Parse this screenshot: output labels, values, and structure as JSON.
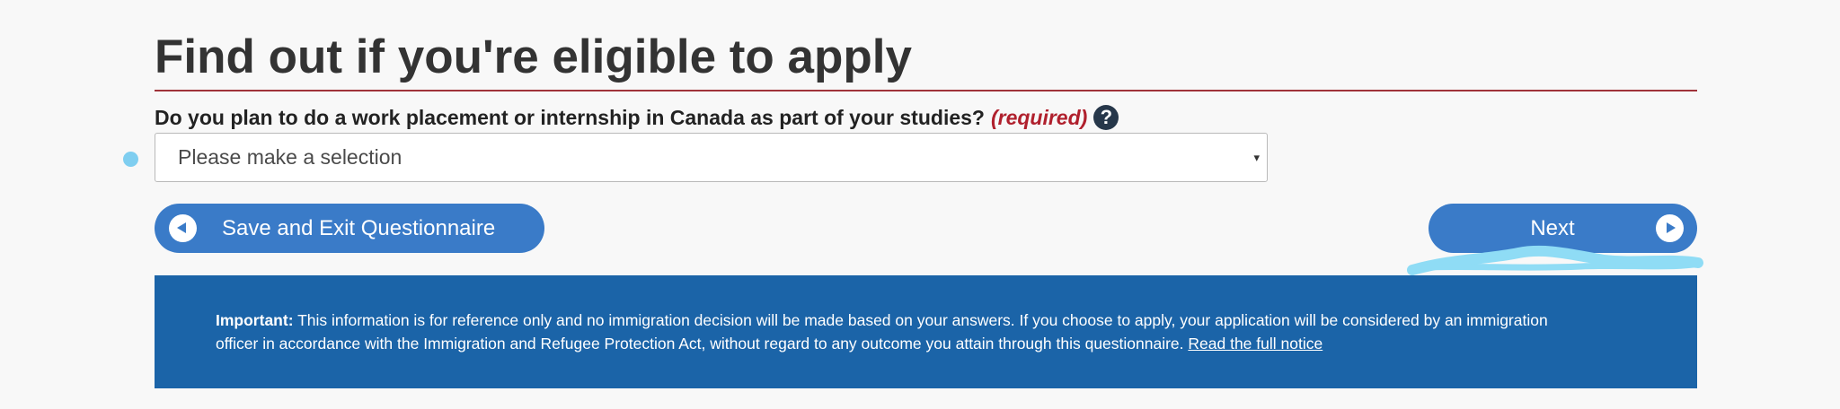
{
  "page_title": "Find out if you're eligible to apply",
  "question": {
    "label": "Do you plan to do a work placement or internship in Canada as part of your studies?",
    "required_text": "(required)",
    "help_symbol": "?"
  },
  "select": {
    "value": "Please make a selection",
    "arrow": "▾"
  },
  "buttons": {
    "save_exit_label": "Save and Exit Questionnaire",
    "next_label": "Next"
  },
  "notice": {
    "important_label": "Important:",
    "line1": " This information is for reference only and no immigration decision will be made based on your answers. If you choose to apply, your application will be considered by an immigration",
    "line2": "officer in accordance with the Immigration and Refugee Protection Act, without regard to any outcome you attain through this questionnaire. ",
    "link": "Read the full notice"
  },
  "icons": {
    "help": "question-mark-circle-icon",
    "back": "arrow-left-circle-icon",
    "next": "arrow-right-circle-icon"
  },
  "colors": {
    "page_background": "#f8f8f8",
    "title_rule": "#a0333a",
    "required": "#b0202d",
    "button": "#3a7bc8",
    "notice_background": "#1b64a8",
    "help_icon": "#26374a",
    "annotation_marker": "#7fcef0"
  }
}
